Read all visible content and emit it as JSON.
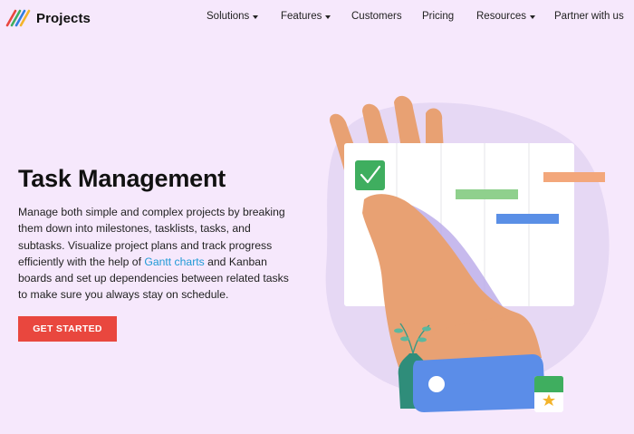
{
  "header": {
    "logo_text": "Projects",
    "nav": [
      {
        "label": "Solutions",
        "dropdown": true
      },
      {
        "label": "Features",
        "dropdown": true
      },
      {
        "label": "Customers",
        "dropdown": false
      },
      {
        "label": "Pricing",
        "dropdown": false
      },
      {
        "label": "Resources",
        "dropdown": true
      },
      {
        "label": "Partner with us",
        "dropdown": false
      }
    ]
  },
  "hero": {
    "title": "Task Management",
    "description_before": "Manage both simple and complex projects by breaking them down into milestones, tasklists, tasks, and subtasks. Visualize project plans and track progress efficiently with the help of ",
    "description_link": "Gantt charts",
    "description_after": " and Kanban boards and set up dependencies between related tasks to make sure you always stay on schedule.",
    "cta_label": "GET STARTED"
  },
  "colors": {
    "background": "#f6e8fc",
    "accent_red": "#e9473e",
    "link_blue": "#1f9ad6",
    "bar_orange": "#f3a77b",
    "bar_green": "#8fd08d",
    "bar_blue": "#5a8fe6",
    "checkbox_green": "#3fae5f",
    "hand_skin": "#e8a173",
    "sleeve_blue": "#5b8de8"
  }
}
